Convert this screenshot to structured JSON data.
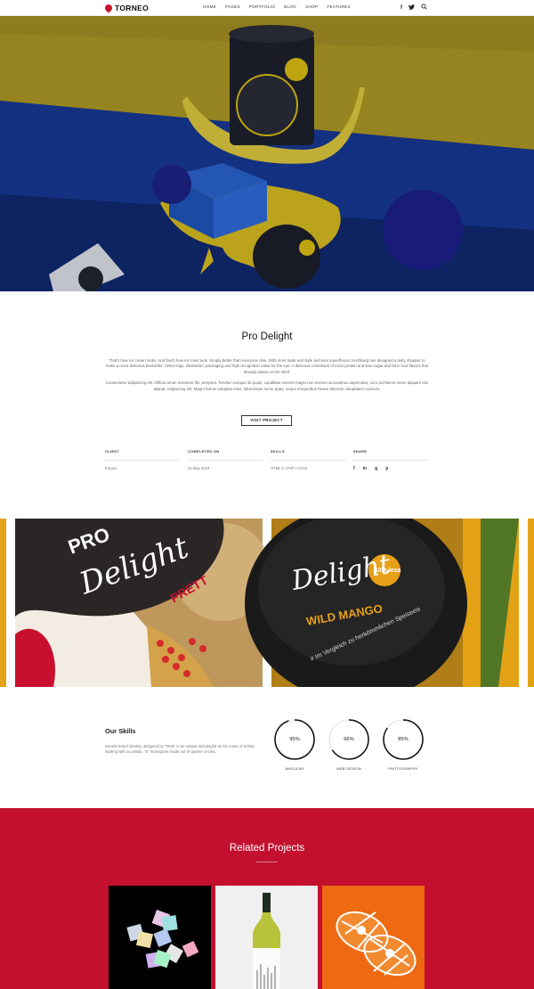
{
  "header": {
    "logo": "TORNEO",
    "nav": [
      "HOME",
      "PAGES",
      "PORTFOLIO",
      "BLOG",
      "SHOP",
      "FEATURES"
    ],
    "social": {
      "facebook": "f",
      "twitter": "t",
      "search": "search-icon"
    }
  },
  "project": {
    "title": "Pro Delight",
    "desc_1": "That's how ice cream looks. And that's how ice must look. Simply better than everyone else. With more taste and style and less superfluous. Hochburg has designed a tasty shopper to make a more delicious bestseller. Velvet logo, illustration, packaging and high recognition value for the eye. A delicious comeback of more protein and less sugar and fat in four flavors that already tastes on the shelf.",
    "desc_2": "Consectetur adipisicing elit. Officia rerum inventore illo, tempora. Tenetur cumque sit quasi, cupiditate esse/et magni non eveniet accusamus aspernatur, cum architecto nemo aliquam iste aliquid. Adipisicing elit. Magni harum voluptas esse, laboriosam nemo quas, neque temporibus facere laborum voluptatem nostrum.",
    "visit_button": "VISIT PROJECT",
    "meta": {
      "client_label": "CLIENT",
      "client_value": "Envato",
      "completed_label": "COMPLETED ON",
      "completed_value": "22 May 2018",
      "skills_label": "SKILLS",
      "skills_value": "HTML 5 / PHP / CSS3",
      "share_label": "SHARE"
    },
    "share_icons": [
      "f",
      "in",
      "g",
      "p"
    ]
  },
  "gallery": {
    "label_1": "PRO",
    "label_2": "Delight",
    "label_3": "PRETT",
    "label_4": "WILD MANGO",
    "label_5": "10% less",
    "label_6": "# Im Vergleich zu herkömmlichen Speiseeis"
  },
  "skills_section": {
    "title": "Our Skills",
    "desc": "Soneht brand identity, designed by TRUF, is as unique and playful as his roster of artists, starting with an artistic \"X\" monogram made out of quarter circles.",
    "items": [
      {
        "label": "ANGULAR",
        "value": "95%",
        "percent": 95
      },
      {
        "label": "WEB DESIGN",
        "value": "66%",
        "percent": 66
      },
      {
        "label": "PHOTOGRAPHY",
        "value": "85%",
        "percent": 85
      }
    ]
  },
  "related": {
    "title": "Related Projects"
  },
  "colors": {
    "accent": "#c3102f",
    "yellow": "#e8c90a",
    "blue": "#1f5fbf",
    "navy": "#1a1f8c"
  }
}
